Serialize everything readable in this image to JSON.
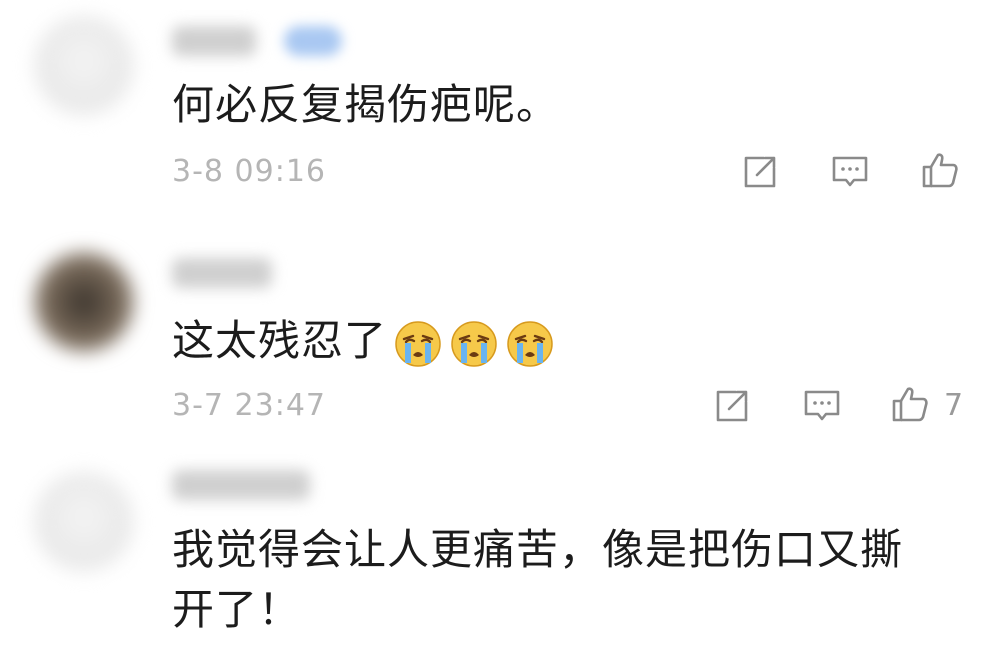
{
  "comments": [
    {
      "text": "何必反复揭伤疤呢。",
      "time": "3-8 09:16",
      "likes": ""
    },
    {
      "text": "这太残忍了",
      "emoji_count": 3,
      "emoji": "crying-face-icon",
      "time": "3-7 23:47",
      "likes": "7"
    },
    {
      "text": "我觉得会让人更痛苦，像是把伤口又撕开了！"
    }
  ],
  "colors": {
    "text": "#1c1c1c",
    "meta": "#b5b5b5",
    "icon": "#8a8a8a"
  }
}
